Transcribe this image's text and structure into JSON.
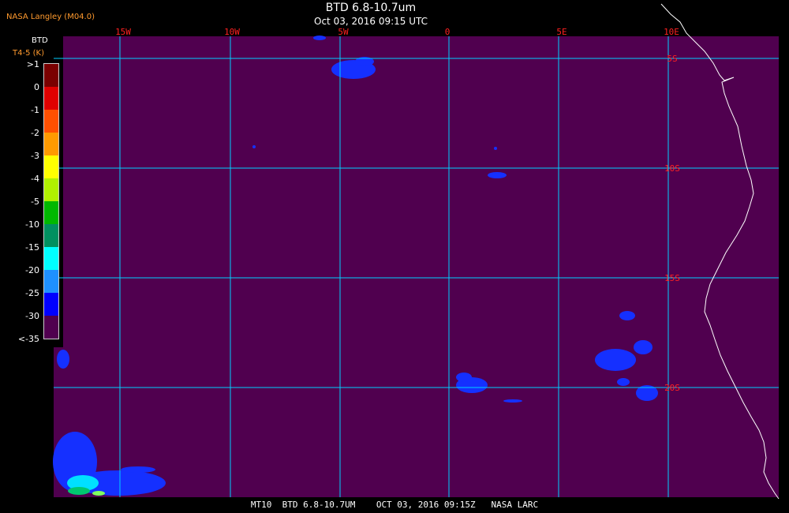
{
  "header": {
    "agency": "NASA Langley (M04.0)",
    "title": "BTD 6.8-10.7um",
    "subtitle": "Oct 03, 2016 09:15 UTC"
  },
  "legend": {
    "heading": "BTD",
    "subheading": "T4-5 (K)",
    "labels": [
      ">1",
      "0",
      "-1",
      "-2",
      "-3",
      "-4",
      "-5",
      "-10",
      "-15",
      "-20",
      "-25",
      "-30",
      "<-35"
    ],
    "colors": [
      "#7a0000",
      "#e00000",
      "#ff5000",
      "#ff9a00",
      "#ffff00",
      "#b0f000",
      "#00b800",
      "#009060",
      "#00ffff",
      "#1e90ff",
      "#0000ff",
      "#50004f"
    ]
  },
  "map": {
    "background_color": "#50004f",
    "grid_color": "#00d0ff",
    "label_color": "#ff2020",
    "coast_color": "#ffffff",
    "longitude_labels": [
      "15W",
      "10W",
      "5W",
      "0",
      "5E",
      "10E"
    ],
    "latitude_labels": [
      "5S",
      "10S",
      "15S",
      "20S"
    ]
  },
  "footer": {
    "text": "MT10  BTD 6.8-10.7UM    OCT 03, 2016 09:15Z   NASA LARC"
  }
}
